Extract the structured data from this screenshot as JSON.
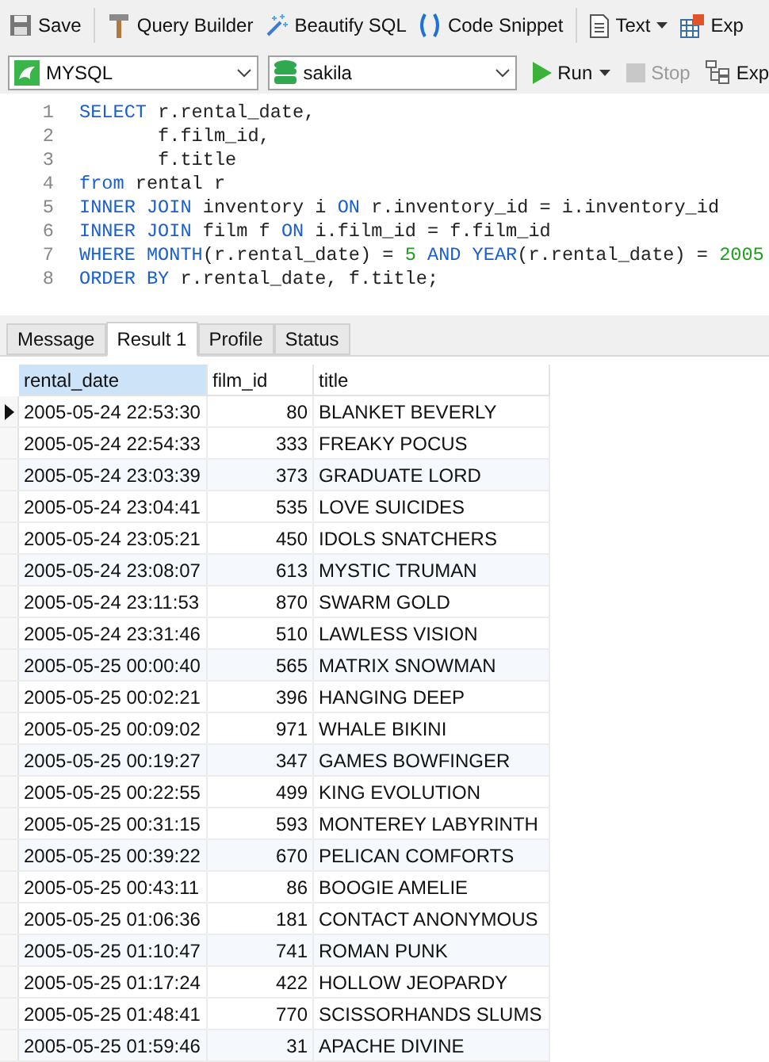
{
  "toolbar": [
    {
      "kind": "save",
      "label": "Save",
      "dropdown": false
    },
    {
      "kind": "builder",
      "label": "Query Builder",
      "dropdown": false
    },
    {
      "kind": "beautify",
      "label": "Beautify SQL",
      "dropdown": false
    },
    {
      "kind": "snippet",
      "label": "Code Snippet",
      "dropdown": false
    },
    {
      "kind": "text",
      "label": "Text",
      "dropdown": true
    },
    {
      "kind": "export",
      "label": "Exp",
      "dropdown": false
    }
  ],
  "connection": {
    "value": "MYSQL"
  },
  "database": {
    "value": "sakila"
  },
  "run_bar": [
    {
      "kind": "run",
      "label": "Run",
      "dropdown": true,
      "disabled": false
    },
    {
      "kind": "stop",
      "label": "Stop",
      "dropdown": false,
      "disabled": true
    },
    {
      "kind": "explain",
      "label": "Exp",
      "dropdown": false,
      "disabled": false
    }
  ],
  "editor": {
    "lines": [
      {
        "number": "1",
        "tokens": [
          {
            "kind": "keyword",
            "text": "SELECT"
          },
          {
            "kind": "plain",
            "text": " r.rental_date,"
          }
        ]
      },
      {
        "number": "2",
        "tokens": [
          {
            "kind": "plain",
            "text": "       f.film_id,"
          }
        ]
      },
      {
        "number": "3",
        "tokens": [
          {
            "kind": "plain",
            "text": "       f.title"
          }
        ]
      },
      {
        "number": "4",
        "tokens": [
          {
            "kind": "keyword",
            "text": "from"
          },
          {
            "kind": "plain",
            "text": " rental r"
          }
        ]
      },
      {
        "number": "5",
        "tokens": [
          {
            "kind": "keyword",
            "text": "INNER JOIN"
          },
          {
            "kind": "plain",
            "text": " inventory i "
          },
          {
            "kind": "keyword",
            "text": "ON"
          },
          {
            "kind": "plain",
            "text": " r.inventory_id = i.inventory_id"
          }
        ]
      },
      {
        "number": "6",
        "tokens": [
          {
            "kind": "keyword",
            "text": "INNER JOIN"
          },
          {
            "kind": "plain",
            "text": " film f "
          },
          {
            "kind": "keyword",
            "text": "ON"
          },
          {
            "kind": "plain",
            "text": " i.film_id = f.film_id"
          }
        ]
      },
      {
        "number": "7",
        "tokens": [
          {
            "kind": "keyword",
            "text": "WHERE MONTH"
          },
          {
            "kind": "plain",
            "text": "(r.rental_date) = "
          },
          {
            "kind": "number",
            "text": "5"
          },
          {
            "kind": "keyword",
            "text": " AND YEAR"
          },
          {
            "kind": "plain",
            "text": "(r.rental_date) = "
          },
          {
            "kind": "number",
            "text": "2005"
          }
        ]
      },
      {
        "number": "8",
        "tokens": [
          {
            "kind": "keyword",
            "text": "ORDER BY"
          },
          {
            "kind": "plain",
            "text": " r.rental_date, f.title;"
          }
        ]
      }
    ]
  },
  "result_tabs": [
    {
      "label": "Message",
      "selected": false
    },
    {
      "label": "Result 1",
      "selected": true
    },
    {
      "label": "Profile",
      "selected": false
    },
    {
      "label": "Status",
      "selected": false
    }
  ],
  "table": {
    "columns": [
      {
        "label": "rental_date",
        "selected": true
      },
      {
        "label": "film_id",
        "selected": false
      },
      {
        "label": "title",
        "selected": false
      }
    ],
    "rows": [
      {
        "cells": [
          "2005-05-24 22:53:30",
          "80",
          "BLANKET BEVERLY"
        ],
        "selected": true
      },
      {
        "cells": [
          "2005-05-24 22:54:33",
          "333",
          "FREAKY POCUS"
        ],
        "selected": false
      },
      {
        "cells": [
          "2005-05-24 23:03:39",
          "373",
          "GRADUATE LORD"
        ],
        "selected": false
      },
      {
        "cells": [
          "2005-05-24 23:04:41",
          "535",
          "LOVE SUICIDES"
        ],
        "selected": false
      },
      {
        "cells": [
          "2005-05-24 23:05:21",
          "450",
          "IDOLS SNATCHERS"
        ],
        "selected": false
      },
      {
        "cells": [
          "2005-05-24 23:08:07",
          "613",
          "MYSTIC TRUMAN"
        ],
        "selected": false
      },
      {
        "cells": [
          "2005-05-24 23:11:53",
          "870",
          "SWARM GOLD"
        ],
        "selected": false
      },
      {
        "cells": [
          "2005-05-24 23:31:46",
          "510",
          "LAWLESS VISION"
        ],
        "selected": false
      },
      {
        "cells": [
          "2005-05-25 00:00:40",
          "565",
          "MATRIX SNOWMAN"
        ],
        "selected": false
      },
      {
        "cells": [
          "2005-05-25 00:02:21",
          "396",
          "HANGING DEEP"
        ],
        "selected": false
      },
      {
        "cells": [
          "2005-05-25 00:09:02",
          "971",
          "WHALE BIKINI"
        ],
        "selected": false
      },
      {
        "cells": [
          "2005-05-25 00:19:27",
          "347",
          "GAMES BOWFINGER"
        ],
        "selected": false
      },
      {
        "cells": [
          "2005-05-25 00:22:55",
          "499",
          "KING EVOLUTION"
        ],
        "selected": false
      },
      {
        "cells": [
          "2005-05-25 00:31:15",
          "593",
          "MONTEREY LABYRINTH"
        ],
        "selected": false
      },
      {
        "cells": [
          "2005-05-25 00:39:22",
          "670",
          "PELICAN COMFORTS"
        ],
        "selected": false
      },
      {
        "cells": [
          "2005-05-25 00:43:11",
          "86",
          "BOOGIE AMELIE"
        ],
        "selected": false
      },
      {
        "cells": [
          "2005-05-25 01:06:36",
          "181",
          "CONTACT ANONYMOUS"
        ],
        "selected": false
      },
      {
        "cells": [
          "2005-05-25 01:10:47",
          "741",
          "ROMAN PUNK"
        ],
        "selected": false
      },
      {
        "cells": [
          "2005-05-25 01:17:24",
          "422",
          "HOLLOW JEOPARDY"
        ],
        "selected": false
      },
      {
        "cells": [
          "2005-05-25 01:48:41",
          "770",
          "SCISSORHANDS SLUMS"
        ],
        "selected": false
      },
      {
        "cells": [
          "2005-05-25 01:59:46",
          "31",
          "APACHE DIVINE"
        ],
        "selected": false
      }
    ]
  }
}
